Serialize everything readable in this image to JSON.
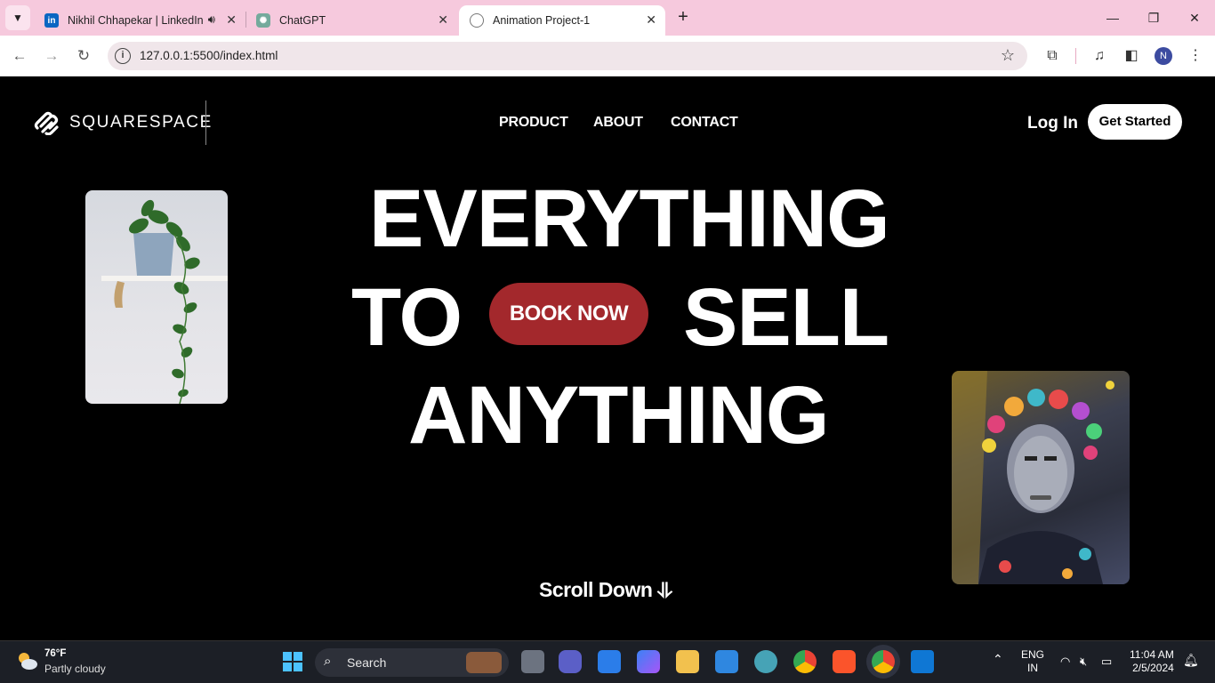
{
  "browser": {
    "tabs": [
      {
        "title": "Nikhil Chhapekar | LinkedIn",
        "favicon": "linkedin-icon",
        "audio": true
      },
      {
        "title": "ChatGPT",
        "favicon": "chatgpt-icon"
      },
      {
        "title": "Animation Project-1",
        "favicon": "globe-icon",
        "active": true
      }
    ],
    "url": "127.0.0.1:5500/index.html",
    "profile_initial": "N"
  },
  "site": {
    "logo_text": "SQUARESPACE",
    "nav": [
      "PRODUCT",
      "ABOUT",
      "CONTACT"
    ],
    "login": "Log In",
    "cta": "Get Started",
    "hero": {
      "line1": "EVERYTHING",
      "line2_left": "TO",
      "line2_right": "SELL",
      "line3": "ANYTHING",
      "button": "BOOK NOW"
    },
    "scroll_text": "Scroll Down ⥥",
    "colors": {
      "accent": "#a3282c",
      "background": "#000000"
    }
  },
  "taskbar": {
    "weather_temp": "76°F",
    "weather_desc": "Partly cloudy",
    "search_label": "Search",
    "lang_top": "ENG",
    "lang_bottom": "IN",
    "time": "11:04 AM",
    "date": "2/5/2024"
  }
}
